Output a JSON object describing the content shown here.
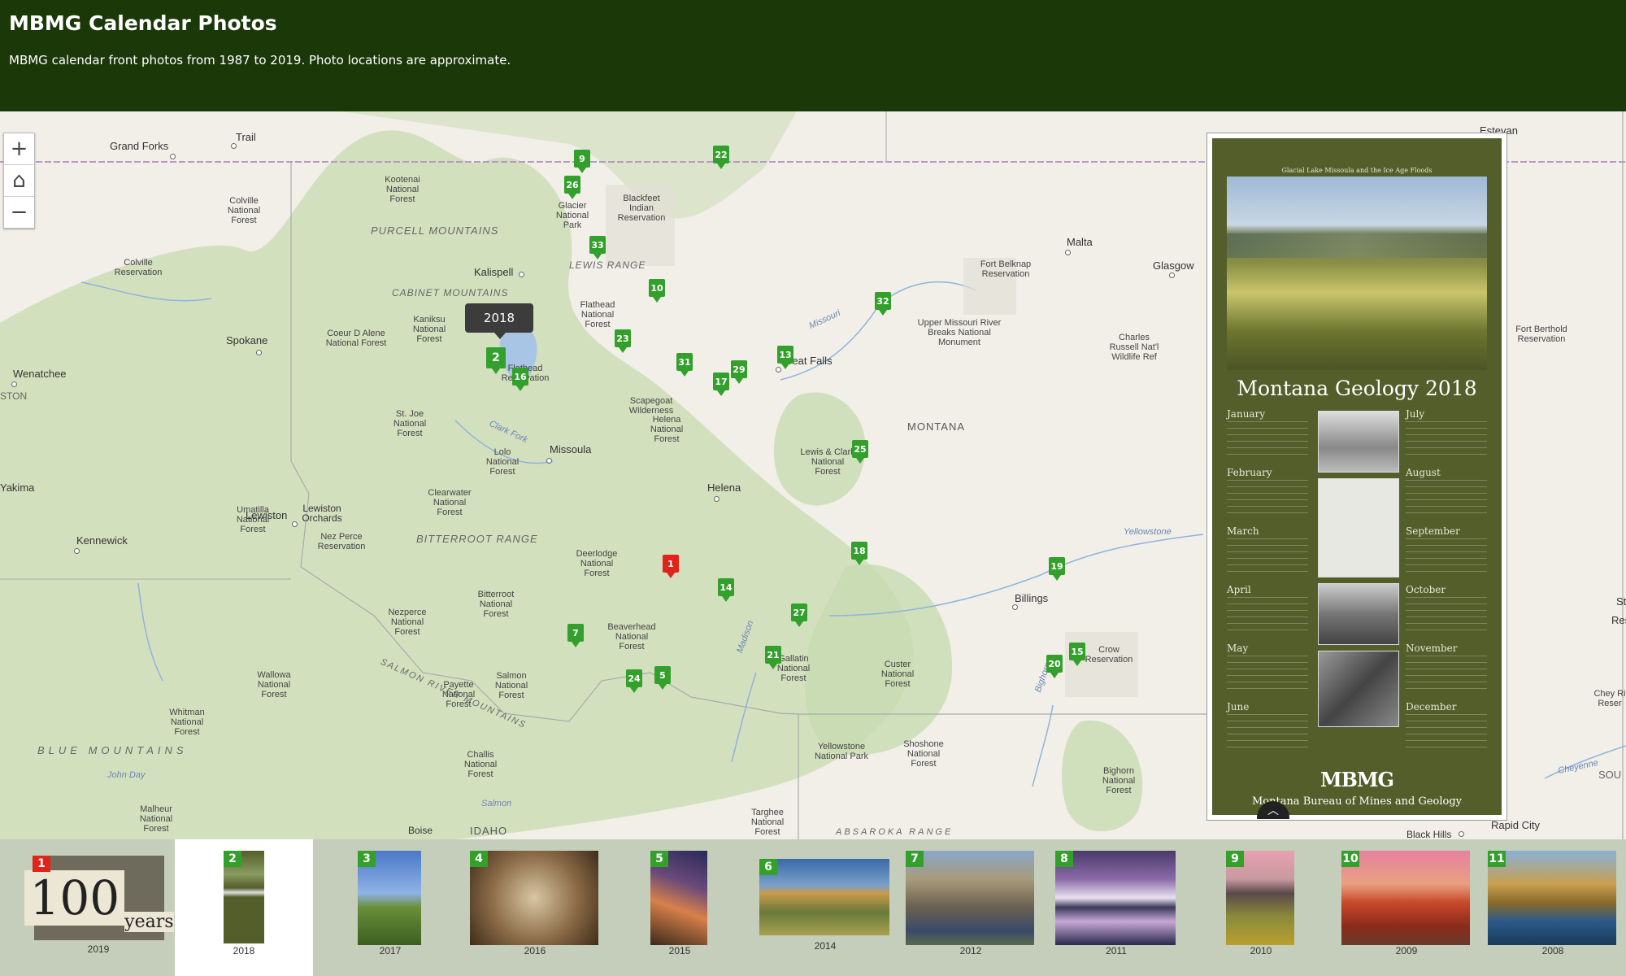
{
  "header": {
    "title": "MBMG Calendar Photos",
    "subtitle": "MBMG calendar front photos from 1987 to 2019. Photo locations are approximate."
  },
  "controls": {
    "zoom_in": "+",
    "home": "⌂",
    "zoom_out": "−"
  },
  "tooltip": "2018",
  "places": {
    "grand_forks": "Grand Forks",
    "trail": "Trail",
    "kootenai": "Kootenai National Forest",
    "purcell": "PURCELL MOUNTAINS",
    "colville_nf": "Colville National Forest",
    "colville_res": "Colville Reservation",
    "blackfeet": "Blackfeet Indian Reservation",
    "glacier": "Glacier National Park",
    "lewis_range": "LEWIS RANGE",
    "kalispell": "Kalispell",
    "cabinet": "CABINET MOUNTAINS",
    "kaniksu": "Kaniksu National Forest",
    "flathead_nf": "Flathead National Forest",
    "spokane": "Spokane",
    "coeur": "Coeur D Alene National Forest",
    "wenatchee": "Wenatchee",
    "ston": "STON",
    "flathead_res": "Flathead Reservation",
    "scapegoat": "Scapegoat Wilderness",
    "helena_nf": "Helena National Forest",
    "st_joe": "St. Joe National Forest",
    "clark_fork": "Clark Fork",
    "missoula": "Missoula",
    "lolo": "Lolo National Forest",
    "yakima": "Yakima",
    "lewiston": "Lewiston",
    "lewiston_orchards": "Lewiston Orchards",
    "kennewick": "Kennewick",
    "umatilla": "Umatilla National Forest",
    "nez_perce_res": "Nez Perce Reservation",
    "clearwater": "Clearwater National Forest",
    "bitterroot_range": "BITTERROOT RANGE",
    "deerlodge": "Deerlodge National Forest",
    "bitterroot_nf": "Bitterroot National Forest",
    "nezperce_nf": "Nezperce National Forest",
    "beaverhead": "Beaverhead National Forest",
    "salmon_river": "SALMON RIVER MOUNTAINS",
    "wallowa": "Wallowa National Forest",
    "payette": "Payette National Forest",
    "salmon_nf": "Salmon National Forest",
    "whitman": "Whitman National Forest",
    "blue_mountains": "BLUE MOUNTAINS",
    "challis": "Challis National Forest",
    "john_day": "John Day",
    "salmon": "Salmon",
    "malheur": "Malheur National Forest",
    "boise": "Boise",
    "idaho": "IDAHO",
    "helena": "Helena",
    "great_falls": "Great Falls",
    "missouri": "Missouri",
    "lewis_clark": "Lewis & Clark National Forest",
    "montana": "MONTANA",
    "malta": "Malta",
    "fort_belknap": "Fort Belknap Reservation",
    "glasgow": "Glasgow",
    "upper_missouri": "Upper Missouri River Breaks National Monument",
    "charles_russell": "Charles Russell Nat'l Wildlife Ref",
    "fort_berthold": "Fort Berthold Reservation",
    "estevan": "Estevan",
    "yellowstone_river": "Yellowstone",
    "billings": "Billings",
    "crow": "Crow Reservation",
    "gallatin": "Gallatin National Forest",
    "custer": "Custer National Forest",
    "yellowstone_np": "Yellowstone National Park",
    "shoshone": "Shoshone National Forest",
    "bighorn_nf": "Bighorn National Forest",
    "bighorn": "Bighorn",
    "madison": "Madison",
    "targhee": "Targhee National Forest",
    "absaroka": "ABSAROKA RANGE",
    "black_hills": "Black Hills",
    "rapid_city": "Rapid City",
    "cheyenne": "Cheyenne",
    "sou": "SOU",
    "st": "St",
    "res": "Res",
    "chey_right": "Chey Ri Reser"
  },
  "markers": [
    {
      "label": "1",
      "active": true
    },
    {
      "label": "2",
      "big": true
    },
    {
      "label": "9"
    },
    {
      "label": "22"
    },
    {
      "label": "26"
    },
    {
      "label": "33"
    },
    {
      "label": "10"
    },
    {
      "label": "32"
    },
    {
      "label": "23"
    },
    {
      "label": "31"
    },
    {
      "label": "29"
    },
    {
      "label": "17"
    },
    {
      "label": "13"
    },
    {
      "label": "16"
    },
    {
      "label": "25"
    },
    {
      "label": "18"
    },
    {
      "label": "19"
    },
    {
      "label": "14"
    },
    {
      "label": "27"
    },
    {
      "label": "7"
    },
    {
      "label": "21"
    },
    {
      "label": "24"
    },
    {
      "label": "5"
    },
    {
      "label": "20"
    },
    {
      "label": "15"
    }
  ],
  "poster": {
    "caption": "Glacial Lake Missoula and the Ice Age Floods",
    "title": "Montana Geology 2018",
    "months_left": [
      "January",
      "February",
      "March",
      "April",
      "May",
      "June"
    ],
    "months_right": [
      "July",
      "August",
      "September",
      "October",
      "November",
      "December"
    ],
    "logo": "MBMG",
    "footer": "Montana Bureau of Mines and Geology"
  },
  "thumbnails": [
    {
      "num": "1",
      "year": "2019",
      "red": true
    },
    {
      "num": "2",
      "year": "2018",
      "selected": true
    },
    {
      "num": "3",
      "year": "2017"
    },
    {
      "num": "4",
      "year": "2016"
    },
    {
      "num": "5",
      "year": "2015"
    },
    {
      "num": "6",
      "year": "2014"
    },
    {
      "num": "7",
      "year": "2012"
    },
    {
      "num": "8",
      "year": "2011"
    },
    {
      "num": "9",
      "year": "2010"
    },
    {
      "num": "10",
      "year": "2009"
    },
    {
      "num": "11",
      "year": "2008"
    }
  ],
  "thumb_100_text": "100",
  "thumb_years_text": "years"
}
